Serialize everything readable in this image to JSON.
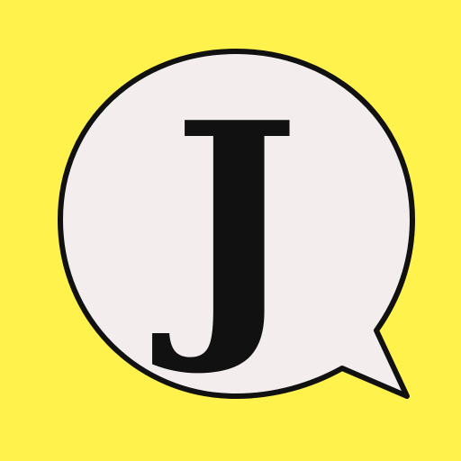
{
  "icon": {
    "letter": "J",
    "colors": {
      "background": "#FFF24C",
      "bubble_fill": "#F3EDEE",
      "outline": "#111111",
      "letter": "#111111"
    },
    "icon_names": [
      "speech-bubble-icon",
      "letter-j-glyph"
    ]
  }
}
